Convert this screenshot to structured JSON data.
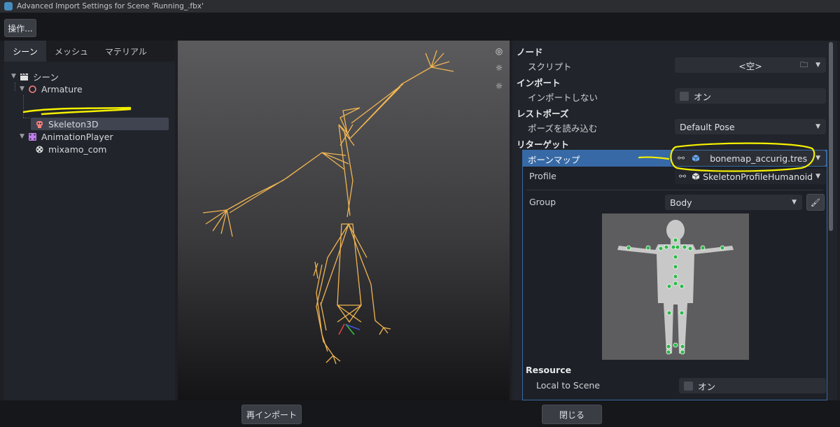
{
  "window": {
    "title": "Advanced Import Settings for Scene 'Running_.fbx'"
  },
  "toolbar": {
    "operations_label": "操作..."
  },
  "left_panel": {
    "tabs": [
      {
        "label": "シーン",
        "active": true
      },
      {
        "label": "メッシュ",
        "active": false
      },
      {
        "label": "マテリアル",
        "active": false
      }
    ],
    "tree": [
      {
        "label": "シーン",
        "icon": "clapperboard-icon"
      },
      {
        "label": "Armature",
        "icon": "node3d-circle-icon"
      },
      {
        "label": "Skeleton3D",
        "icon": "skeleton-icon",
        "selected": true
      },
      {
        "label": "AnimationPlayer",
        "icon": "animation-player-icon"
      },
      {
        "label": "mixamo_com",
        "icon": "animation-icon"
      }
    ]
  },
  "inspector": {
    "node_section": "ノード",
    "script_label": "スクリプト",
    "script_value": "<空>",
    "import_section": "インポート",
    "skip_import_label": "インポートしない",
    "skip_import_value": "オン",
    "rest_pose_section": "レストポーズ",
    "load_pose_label": "ポーズを読み込む",
    "load_pose_value": "Default Pose",
    "retarget_section": "リターゲット",
    "bone_map_label": "ボーンマップ",
    "bone_map_value": "bonemap_accurig.tres",
    "profile_label": "Profile",
    "profile_value": "SkeletonProfileHumanoid",
    "group_label": "Group",
    "group_value": "Body",
    "resource_section": "Resource",
    "local_to_scene_label": "Local to Scene",
    "local_to_scene_value": "オン"
  },
  "footer": {
    "reimport_label": "再インポート",
    "close_label": "閉じる"
  },
  "colors": {
    "accent": "#3769a6",
    "bone": "#e8b04a",
    "annotation": "#f5f000",
    "joint": "#2eb84a"
  }
}
